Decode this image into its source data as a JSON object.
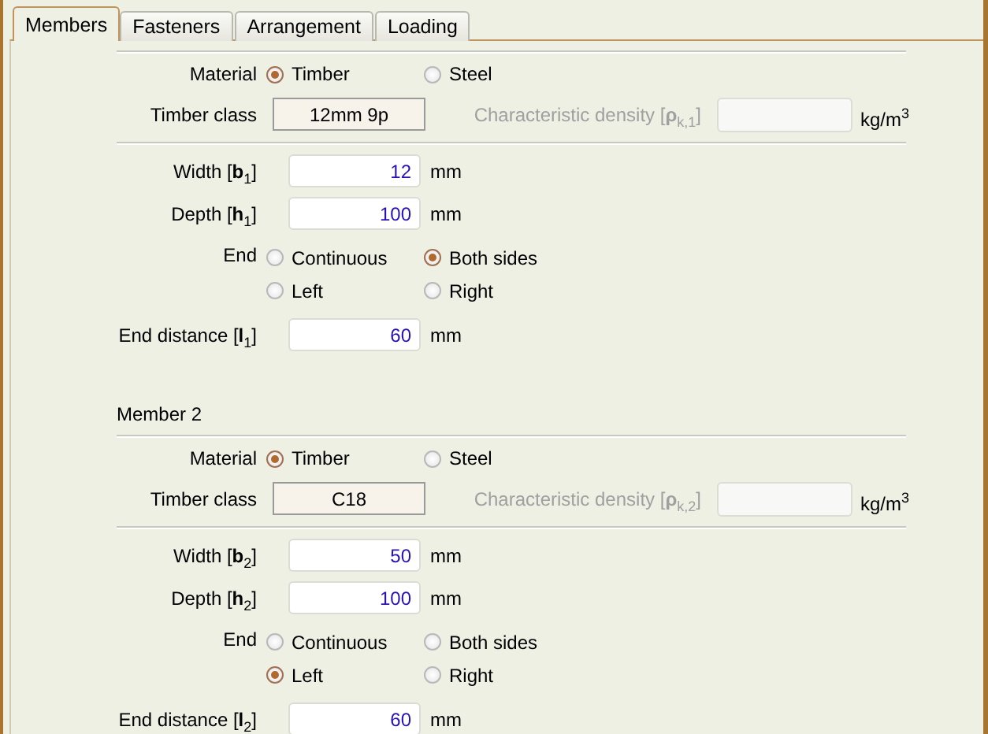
{
  "tabs": [
    {
      "label": "Members",
      "selected": true
    },
    {
      "label": "Fasteners",
      "selected": false
    },
    {
      "label": "Arrangement",
      "selected": false
    },
    {
      "label": "Loading",
      "selected": false
    }
  ],
  "members": [
    {
      "material": {
        "label": "Material",
        "options": [
          {
            "label": "Timber",
            "selected": true
          },
          {
            "label": "Steel",
            "selected": false
          }
        ]
      },
      "timber_class": {
        "label": "Timber class",
        "value": "12mm 9p"
      },
      "density": {
        "label": "Characteristic density [**ρ**$_{k,1}$]",
        "unit": "kg/m$^{3}$",
        "disabled": true
      },
      "width": {
        "label": "Width [**b**$_{1}$]",
        "value": "12",
        "unit": "mm"
      },
      "depth": {
        "label": "Depth [**h**$_{1}$]",
        "value": "100",
        "unit": "mm"
      },
      "end": {
        "label": "End",
        "options": [
          {
            "label": "Continuous",
            "selected": false
          },
          {
            "label": "Both sides",
            "selected": true
          },
          {
            "label": "Left",
            "selected": false
          },
          {
            "label": "Right",
            "selected": false
          }
        ]
      },
      "end_distance": {
        "label": "End distance [**l**$_{1}$]",
        "value": "60",
        "unit": "mm"
      }
    },
    {
      "heading": "Member 2",
      "material": {
        "label": "Material",
        "options": [
          {
            "label": "Timber",
            "selected": true
          },
          {
            "label": "Steel",
            "selected": false
          }
        ]
      },
      "timber_class": {
        "label": "Timber class",
        "value": "C18"
      },
      "density": {
        "label": "Characteristic density [**ρ**$_{k,2}$]",
        "unit": "kg/m$^{3}$",
        "disabled": true
      },
      "width": {
        "label": "Width [**b**$_{2}$]",
        "value": "50",
        "unit": "mm"
      },
      "depth": {
        "label": "Depth [**h**$_{2}$]",
        "value": "100",
        "unit": "mm"
      },
      "end": {
        "label": "End",
        "options": [
          {
            "label": "Continuous",
            "selected": false
          },
          {
            "label": "Both sides",
            "selected": false
          },
          {
            "label": "Left",
            "selected": true
          },
          {
            "label": "Right",
            "selected": false
          }
        ]
      },
      "end_distance": {
        "label": "End distance [**l**$_{2}$]",
        "value": "60",
        "unit": "mm"
      }
    }
  ]
}
